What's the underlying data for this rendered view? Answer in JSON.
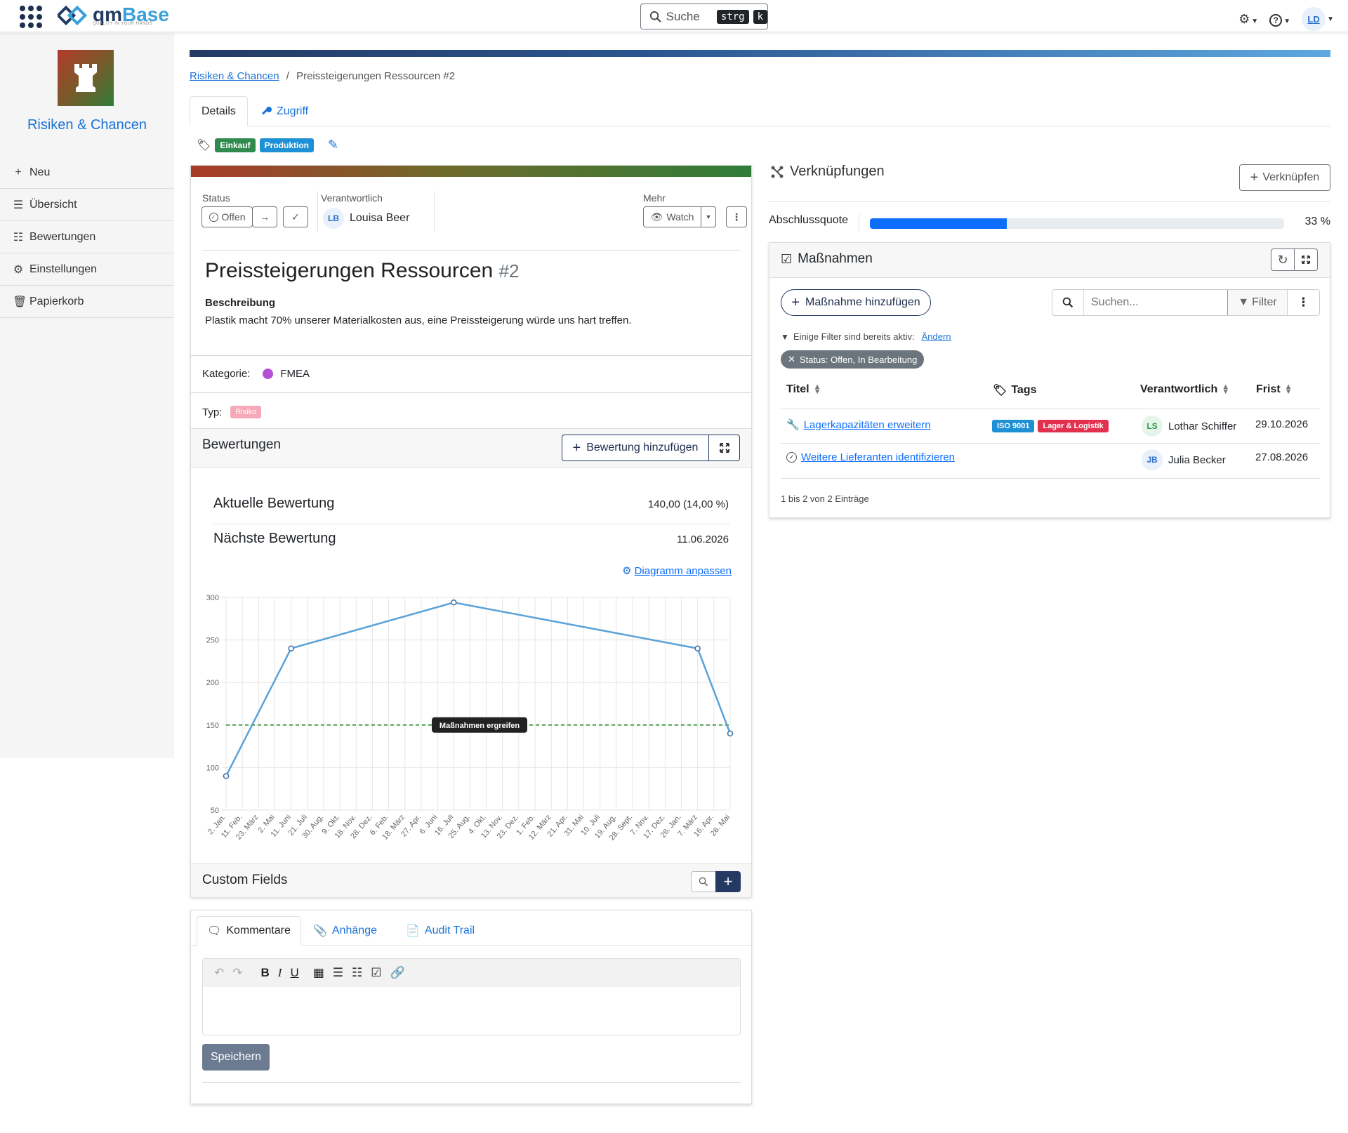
{
  "app": {
    "logo_qm": "qm",
    "logo_base": "Base",
    "logo_sub": "QUALITY IN YOUR HANDS"
  },
  "topbar": {
    "search_label": "Suche",
    "kbd1": "strg",
    "kbd2": "k",
    "user_initials": "LD"
  },
  "sidebar": {
    "module_title": "Risiken & Chancen",
    "items": [
      {
        "icon": "plus-icon",
        "label": "Neu"
      },
      {
        "icon": "list-icon",
        "label": "Übersicht"
      },
      {
        "icon": "list-ordered-icon",
        "label": "Bewertungen"
      },
      {
        "icon": "gear-icon",
        "label": "Einstellungen"
      },
      {
        "icon": "trash-icon",
        "label": "Papierkorb"
      }
    ]
  },
  "breadcrumb": {
    "parent": "Risiken & Chancen",
    "separator": "/",
    "current": "Preissteigerungen Ressourcen #2"
  },
  "tabs": {
    "details": "Details",
    "zugriff": "Zugriff"
  },
  "tags": [
    {
      "label": "Einkauf",
      "color": "#2f8a4e"
    },
    {
      "label": "Produktion",
      "color": "#1e90d6"
    }
  ],
  "record": {
    "status_label": "Status",
    "status_value": "Offen",
    "verantwortlich_label": "Verantwortlich",
    "verantwortlich_initials": "LB",
    "verantwortlich_name": "Louisa Beer",
    "mehr_label": "Mehr",
    "watch_label": "Watch",
    "title": "Preissteigerungen Ressourcen",
    "number": "#2",
    "beschreibung_label": "Beschreibung",
    "beschreibung_text": "Plastik macht 70% unserer Materialkosten aus, eine Preissteigerung würde uns hart treffen.",
    "kategorie_label": "Kategorie:",
    "kategorie_value": "FMEA",
    "kategorie_color": "#b44fd6",
    "typ_label": "Typ:",
    "typ_value": "Risiko"
  },
  "bewertungen": {
    "heading": "Bewertungen",
    "add_button": "Bewertung hinzufügen",
    "aktuelle_label": "Aktuelle Bewertung",
    "aktuelle_value": "140,00 (14,00 %)",
    "naechste_label": "Nächste Bewertung",
    "naechste_value": "11.06.2026",
    "diagramm_link": "Diagramm anpassen"
  },
  "chart_data": {
    "type": "line",
    "x_tick_labels": [
      "2. Jan.",
      "11. Feb.",
      "23. März",
      "2. Mai",
      "11. Juni",
      "21. Juli",
      "30. Aug.",
      "9. Okt.",
      "18. Nov.",
      "28. Dez.",
      "6. Feb.",
      "18. März",
      "27. Apr.",
      "6. Juni",
      "16. Juli",
      "25. Aug.",
      "4. Okt.",
      "13. Nov.",
      "23. Dez.",
      "1. Feb.",
      "12. März",
      "21. Apr.",
      "31. Mai",
      "10. Juli",
      "19. Aug.",
      "28. Sept.",
      "7. Nov.",
      "17. Dez.",
      "26. Jan.",
      "7. März",
      "16. Apr.",
      "26. Mai"
    ],
    "series": [
      {
        "points": [
          {
            "x": "2. Jan.",
            "y": 90
          },
          {
            "x": "11. Juni",
            "y": 240
          },
          {
            "x": "16. Juli",
            "y": 294
          },
          {
            "x": "7. März",
            "y": 240
          },
          {
            "x": "26. Mai",
            "y": 140
          }
        ]
      }
    ],
    "threshold": {
      "value": 150,
      "label": "Maßnahmen ergreifen",
      "color": "#2e8b2e"
    },
    "ylim": [
      50,
      300
    ],
    "y_ticks": [
      300,
      250,
      200,
      150,
      100,
      50
    ],
    "line_color": "#5aa2d8",
    "grid": true
  },
  "custom_fields": {
    "heading": "Custom Fields"
  },
  "comments": {
    "tab_kommentare": "Kommentare",
    "tab_anhaenge": "Anhänge",
    "tab_audit": "Audit Trail",
    "save_button": "Speichern"
  },
  "verknuepfungen": {
    "heading": "Verknüpfungen",
    "button": "Verknüpfen",
    "abschluss_label": "Abschlussquote",
    "abschluss_value": "33 %",
    "abschluss_fraction": 0.33
  },
  "massnahmen": {
    "heading": "Maßnahmen",
    "add_button": "Maßnahme hinzufügen",
    "search_placeholder": "Suchen...",
    "filter_label": "Filter",
    "filter_info": "Einige Filter sind bereits aktiv:",
    "filter_change": "Ändern",
    "active_filter": "Status: Offen, In Bearbeitung",
    "columns": [
      "Titel",
      "Tags",
      "Verantwortlich",
      "Frist"
    ],
    "rows": [
      {
        "icon": "wrench-icon",
        "title": "Lagerkapazitäten erweitern",
        "tags": [
          {
            "label": "ISO 9001",
            "color": "#1e90d6"
          },
          {
            "label": "Lager & Logistik",
            "color": "#e2304e"
          }
        ],
        "initials": "LS",
        "name": "Lothar Schiffer",
        "frist": "29.10.2026"
      },
      {
        "icon": "check-circle-icon",
        "title": "Weitere Lieferanten identifizieren",
        "tags": [],
        "initials": "JB",
        "name": "Julia Becker",
        "frist": "27.08.2026"
      }
    ],
    "footer": "1 bis 2 von 2 Einträge"
  }
}
